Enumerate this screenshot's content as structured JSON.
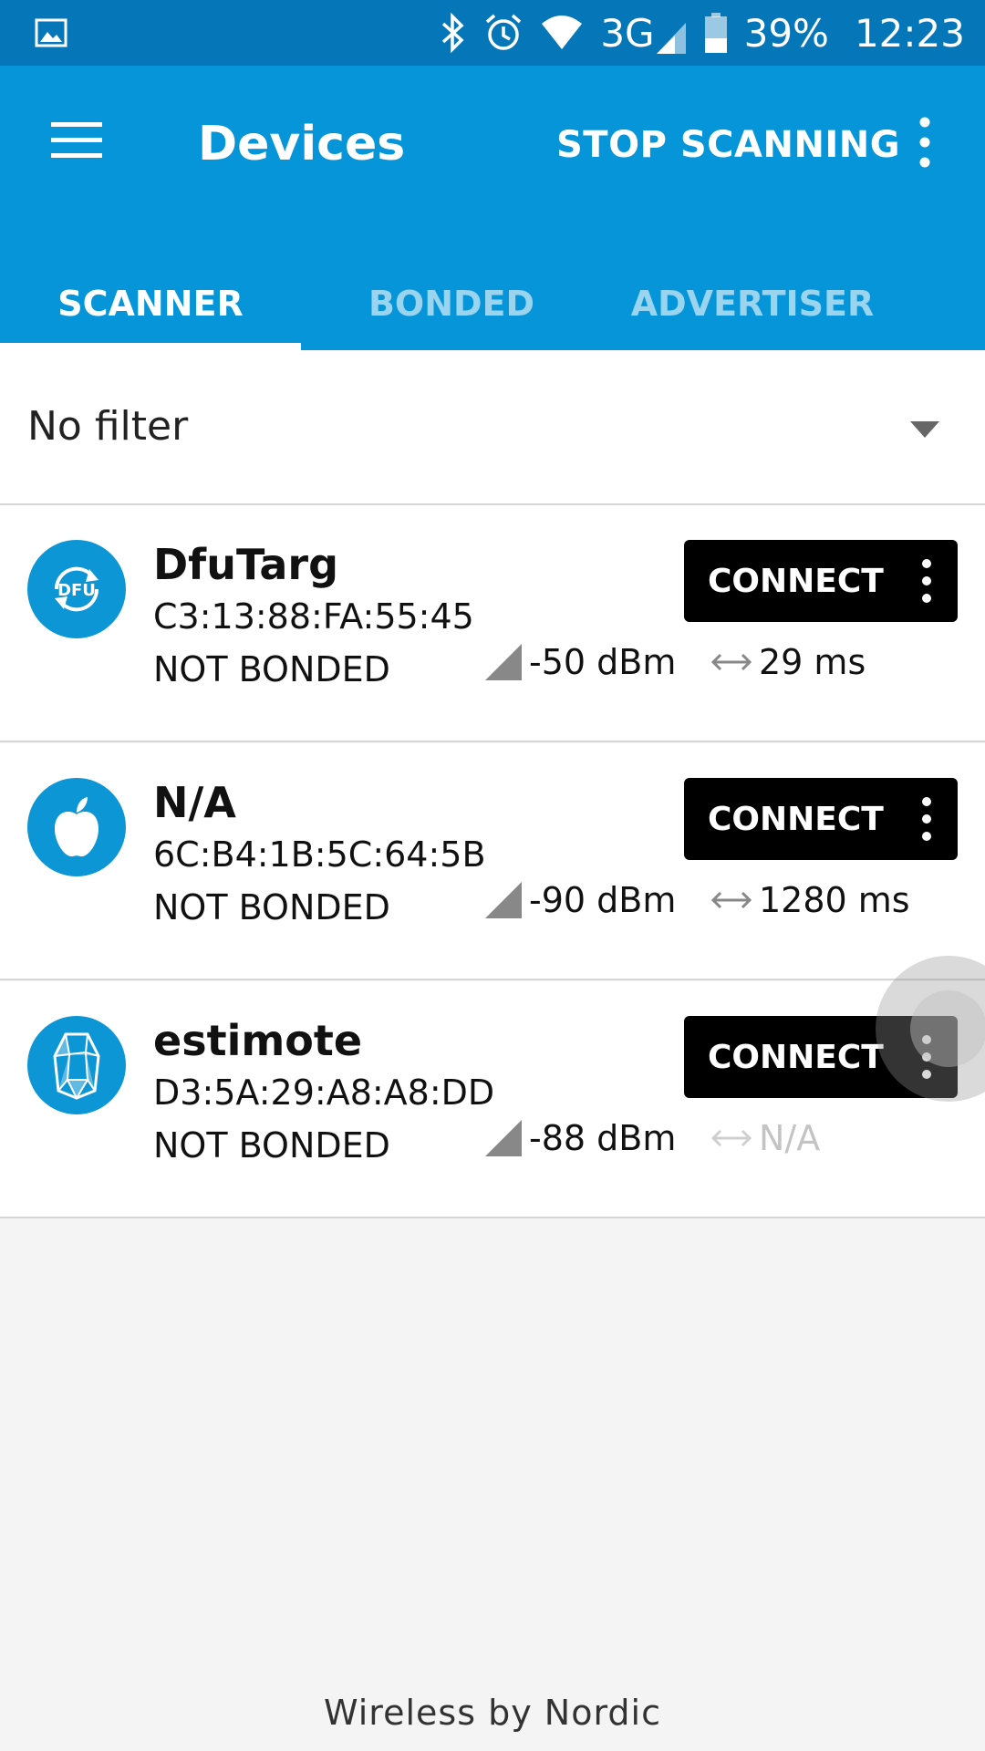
{
  "status_bar": {
    "battery": "39%",
    "network": "3G",
    "time": "12:23",
    "icons": [
      "image-icon",
      "bluetooth-icon",
      "alarm-icon",
      "wifi-icon",
      "cell-signal-icon",
      "battery-icon"
    ]
  },
  "app_bar": {
    "title": "Devices",
    "action": "STOP SCANNING",
    "color": "#0595d8"
  },
  "tabs": [
    {
      "label": "SCANNER",
      "active": true
    },
    {
      "label": "BONDED",
      "active": false
    },
    {
      "label": "ADVERTISER",
      "active": false
    }
  ],
  "filter": {
    "selected": "No filter"
  },
  "devices": [
    {
      "name": "DfuTarg",
      "mac": "C3:13:88:FA:55:45",
      "bond": "NOT BONDED",
      "rssi": "-50 dBm",
      "interval": "29 ms",
      "icon": "dfu-icon",
      "connect_label": "CONNECT"
    },
    {
      "name": "N/A",
      "mac": "6C:B4:1B:5C:64:5B",
      "bond": "NOT BONDED",
      "rssi": "-90 dBm",
      "interval": "1280 ms",
      "icon": "apple-icon",
      "connect_label": "CONNECT"
    },
    {
      "name": "estimote",
      "mac": "D3:5A:29:A8:A8:DD",
      "bond": "NOT BONDED",
      "rssi": "-88 dBm",
      "interval": "N/A",
      "icon": "estimote-beacon-icon",
      "connect_label": "CONNECT"
    }
  ],
  "footer": "Wireless by Nordic"
}
